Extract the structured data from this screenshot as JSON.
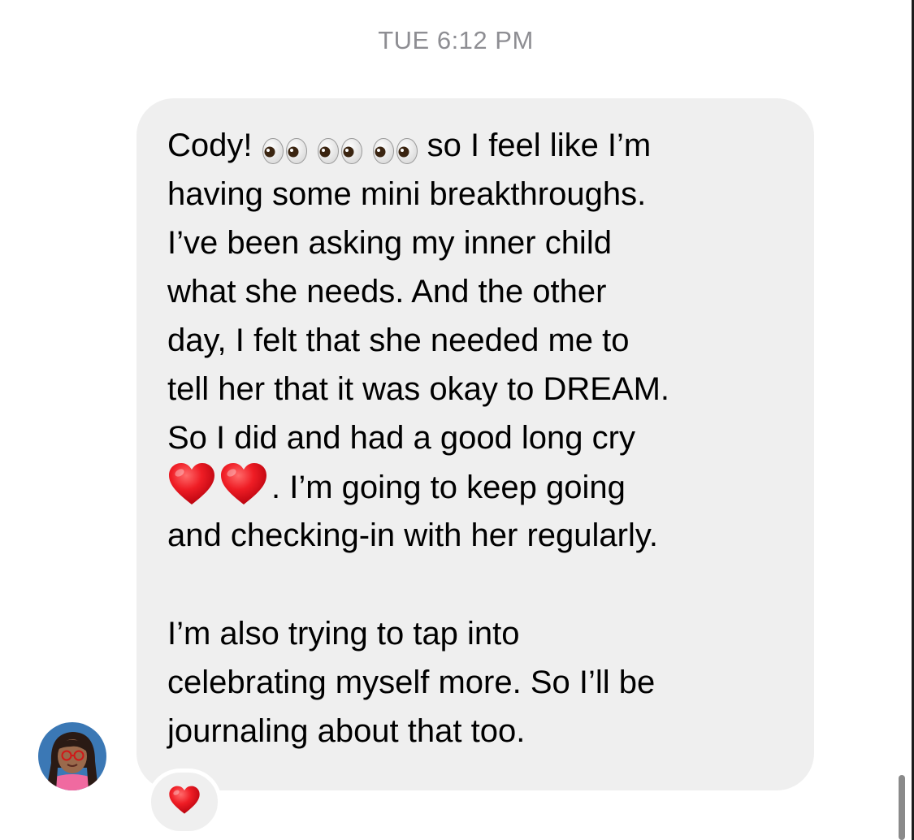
{
  "timestamp": "TUE 6:12 PM",
  "message": {
    "lines": {
      "l1_prefix": "Cody! ",
      "l1_suffix": "so I feel like I’m",
      "l2": "having some mini breakthroughs.",
      "l3": "I’ve been asking my inner child",
      "l4": "what she needs. And the other",
      "l5": "day, I felt that she needed me to",
      "l6": "tell her that it was okay to DREAM.",
      "l7": "So I did and had a good long cry",
      "l8_suffix": ". I’m going to keep going",
      "l9": "and checking-in with her regularly.",
      "l10": "I’m also trying to tap into",
      "l11": "celebrating myself more. So I’ll be",
      "l12": "journaling about that too."
    },
    "inline_emoji": {
      "line1": [
        "eyes",
        "eyes",
        "eyes"
      ],
      "line8": [
        "red-heart",
        "red-heart"
      ]
    }
  },
  "reaction": {
    "emoji": "red-heart"
  },
  "colors": {
    "bubble": "#efefef",
    "text": "#000000",
    "timestamp": "#8e8e93",
    "heart": "#e8131c"
  }
}
